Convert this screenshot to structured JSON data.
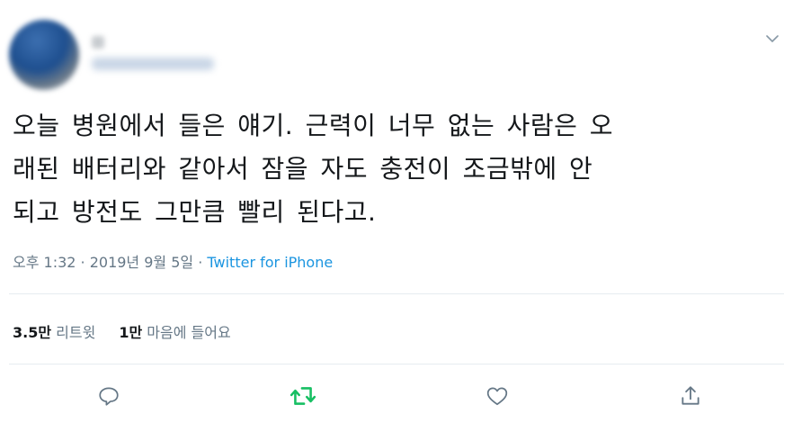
{
  "tweet": {
    "text_lines": [
      "오늘 병원에서 들은 얘기. 근력이 너무 없는 사람은 오",
      "래된 배터리와 같아서 잠을 자도 충전이 조금밖에 안",
      "되고 방전도 그만큼 빨리 된다고."
    ],
    "timestamp": "오후 1:32 · 2019년 9월 5일",
    "separator": " · ",
    "source": "Twitter for iPhone"
  },
  "stats": {
    "retweets_count": "3.5만",
    "retweets_label": "리트윗",
    "likes_count": "1만",
    "likes_label": "마음에 들어요"
  },
  "colors": {
    "text": "#14171a",
    "muted": "#657786",
    "link": "#1b95e0",
    "retweet_active": "#17bf63",
    "divider": "#e6ecf0"
  },
  "icons": {
    "caret": "chevron-down-icon",
    "reply": "reply-icon",
    "retweet": "retweet-icon",
    "like": "heart-icon",
    "share": "share-icon"
  }
}
